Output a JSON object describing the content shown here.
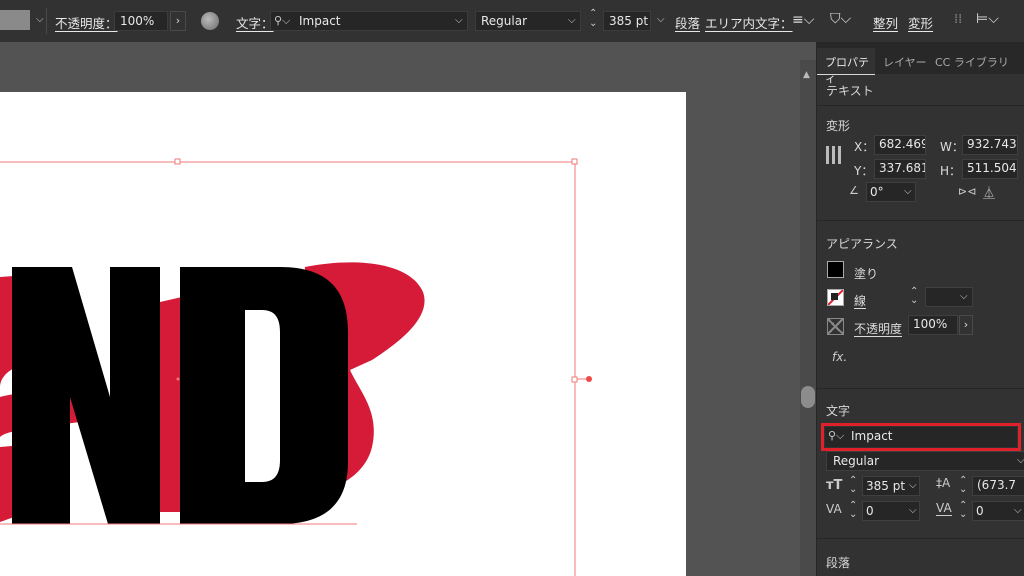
{
  "toolbar": {
    "opacity_label": "不透明度：",
    "opacity_value": "100%",
    "character_label": "文字：",
    "font_family": "Impact",
    "font_style": "Regular",
    "font_size": "385 pt",
    "paragraph_label": "段落",
    "area_text_label": "エリア内文字：",
    "align_label": "整列",
    "transform_label": "変形"
  },
  "artwork": {
    "text": "ND",
    "fill_color": "#000000",
    "accent_color": "#d51b38",
    "bbox_color": "#f37a7a"
  },
  "panel": {
    "tabs": [
      "プロパティ",
      "レイヤー",
      "CC ライブラリ"
    ],
    "text_section": "テキスト",
    "transform": {
      "title": "変形",
      "x_label": "X：",
      "x_value": "682.469",
      "y_label": "Y：",
      "y_value": "337.681",
      "w_label": "W：",
      "w_value": "932.743",
      "h_label": "H：",
      "h_value": "511.504",
      "angle_value": "0°"
    },
    "appearance": {
      "title": "アピアランス",
      "fill_label": "塗り",
      "stroke_label": "線",
      "opacity_label": "不透明度",
      "opacity_value": "100%",
      "fx_label": "fx."
    },
    "character": {
      "title": "文字",
      "font_family": "Impact",
      "font_style": "Regular",
      "size_value": "385 pt",
      "leading_value": "(673.7",
      "kerning_value": "0",
      "tracking_value": "0",
      "highlight_color": "#e0202a"
    },
    "paragraph_title": "段落"
  }
}
